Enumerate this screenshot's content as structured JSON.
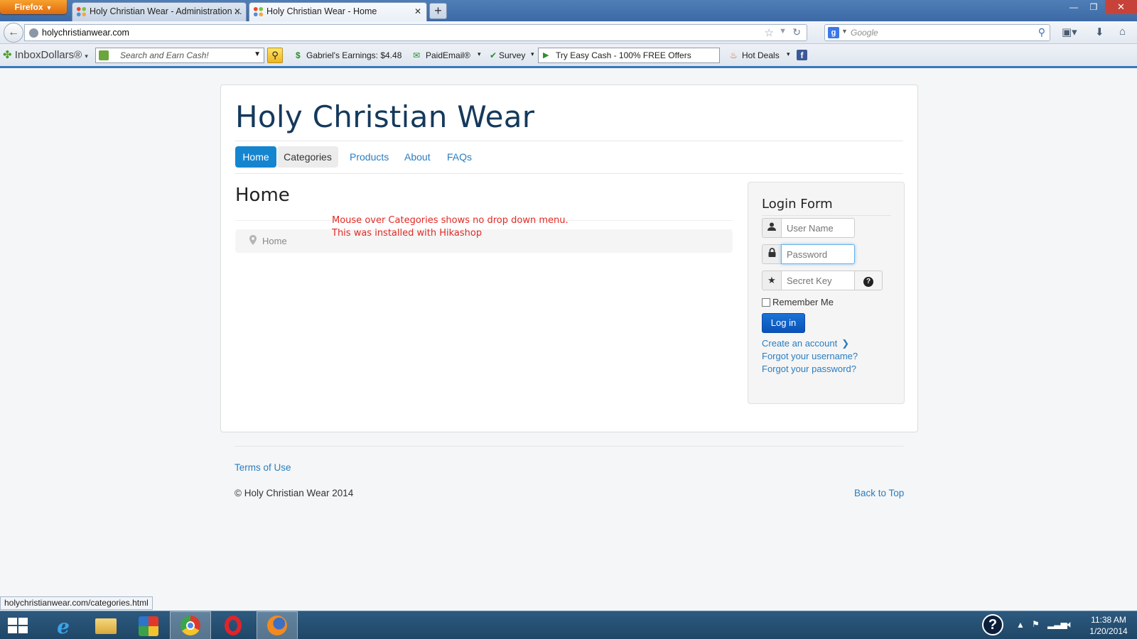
{
  "browser": {
    "app_button": "Firefox",
    "tabs": [
      {
        "label": "Holy Christian Wear - Administration ...",
        "active": false
      },
      {
        "label": "Holy Christian Wear - Home",
        "active": true
      }
    ],
    "new_tab": "+",
    "url": "holychristianwear.com",
    "search_placeholder": "Google",
    "status_url": "holychristianwear.com/categories.html"
  },
  "addon_toolbar": {
    "brand": "InboxDollars®",
    "search_placeholder": "Search and Earn Cash!",
    "earnings": "Gabriel's Earnings: $4.48",
    "paidemail": "PaidEmail®",
    "survey": "Survey",
    "offer": "Try Easy Cash - 100% FREE Offers",
    "hot_deals": "Hot Deals"
  },
  "site": {
    "title": "Holy Christian Wear",
    "menu": [
      {
        "label": "Home",
        "state": "active"
      },
      {
        "label": "Categories",
        "state": "hover"
      },
      {
        "label": "Products",
        "state": "normal"
      },
      {
        "label": "About",
        "state": "normal"
      },
      {
        "label": "FAQs",
        "state": "normal"
      }
    ],
    "page_heading": "Home",
    "breadcrumb": "Home",
    "annotation_line1": "Mouse over Categories shows no drop down menu.",
    "annotation_line2": "This was installed with Hikashop"
  },
  "login": {
    "title": "Login Form",
    "username_placeholder": "User Name",
    "password_placeholder": "Password",
    "secretkey_placeholder": "Secret Key",
    "remember_label": "Remember Me",
    "submit_label": "Log in",
    "create_account": "Create an account",
    "forgot_username": "Forgot your username?",
    "forgot_password": "Forgot your password?"
  },
  "footer": {
    "terms": "Terms of Use",
    "copyright": "© Holy Christian Wear 2014",
    "back_to_top": "Back to Top"
  },
  "taskbar": {
    "time": "11:38 AM",
    "date": "1/20/2014"
  },
  "colors": {
    "accent": "#1585d0",
    "link": "#2a7dc0",
    "annotation": "#e32a24",
    "title": "#15395c"
  }
}
